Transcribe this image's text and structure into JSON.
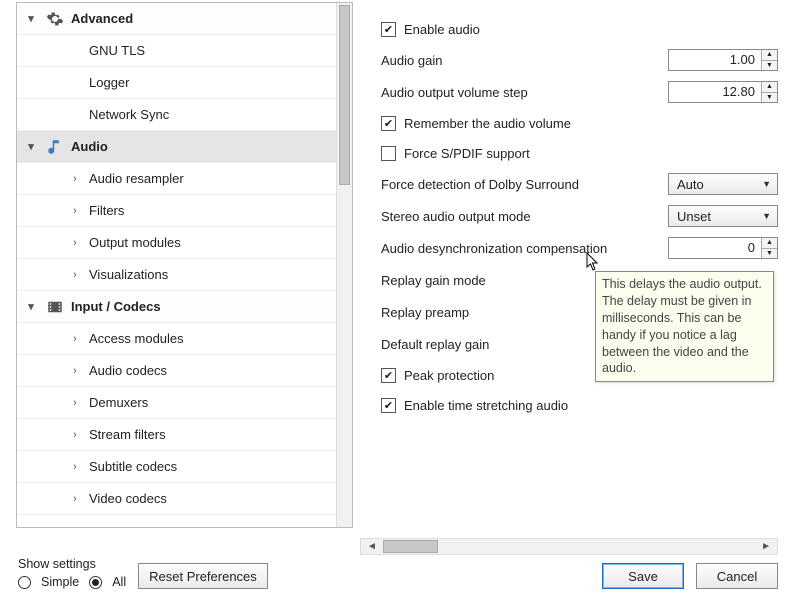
{
  "sidebar": {
    "items": [
      {
        "label": "Advanced",
        "kind": "group",
        "icon": "gear",
        "toggle": "down"
      },
      {
        "label": "GNU TLS",
        "kind": "child"
      },
      {
        "label": "Logger",
        "kind": "child"
      },
      {
        "label": "Network Sync",
        "kind": "child"
      },
      {
        "label": "Audio",
        "kind": "group",
        "icon": "note",
        "toggle": "down",
        "selected": true
      },
      {
        "label": "Audio resampler",
        "kind": "grandchild",
        "toggle": "right"
      },
      {
        "label": "Filters",
        "kind": "grandchild",
        "toggle": "right"
      },
      {
        "label": "Output modules",
        "kind": "grandchild",
        "toggle": "right"
      },
      {
        "label": "Visualizations",
        "kind": "grandchild",
        "toggle": "right"
      },
      {
        "label": "Input / Codecs",
        "kind": "group",
        "icon": "film",
        "toggle": "down"
      },
      {
        "label": "Access modules",
        "kind": "grandchild",
        "toggle": "right"
      },
      {
        "label": "Audio codecs",
        "kind": "grandchild",
        "toggle": "right"
      },
      {
        "label": "Demuxers",
        "kind": "grandchild",
        "toggle": "right"
      },
      {
        "label": "Stream filters",
        "kind": "grandchild",
        "toggle": "right"
      },
      {
        "label": "Subtitle codecs",
        "kind": "grandchild",
        "toggle": "right"
      },
      {
        "label": "Video codecs",
        "kind": "grandchild",
        "toggle": "right"
      }
    ]
  },
  "settings": {
    "enable_audio": {
      "label": "Enable audio",
      "checked": true
    },
    "audio_gain": {
      "label": "Audio gain",
      "value": "1.00"
    },
    "volume_step": {
      "label": "Audio output volume step",
      "value": "12.80"
    },
    "remember_volume": {
      "label": "Remember the audio volume",
      "checked": true
    },
    "force_spdif": {
      "label": "Force S/PDIF support",
      "checked": false
    },
    "dolby": {
      "label": "Force detection of Dolby Surround",
      "value": "Auto"
    },
    "stereo_mode": {
      "label": "Stereo audio output mode",
      "value": "Unset"
    },
    "desync": {
      "label": "Audio desynchronization compensation",
      "value": "0"
    },
    "replay_mode": {
      "label": "Replay gain mode"
    },
    "replay_preamp": {
      "label": "Replay preamp"
    },
    "default_replay": {
      "label": "Default replay gain"
    },
    "peak_protection": {
      "label": "Peak protection",
      "checked": true
    },
    "time_stretch": {
      "label": "Enable time stretching audio",
      "checked": true
    }
  },
  "tooltip": "This delays the audio output. The delay must be given in milliseconds. This can be handy if you notice a lag between the video and the audio.",
  "bottom": {
    "show_settings_label": "Show settings",
    "radio_simple": "Simple",
    "radio_all": "All",
    "reset": "Reset Preferences",
    "save": "Save",
    "cancel": "Cancel"
  },
  "glyphs": {
    "down": "▾",
    "right": "›",
    "arrow_down": "▾"
  }
}
